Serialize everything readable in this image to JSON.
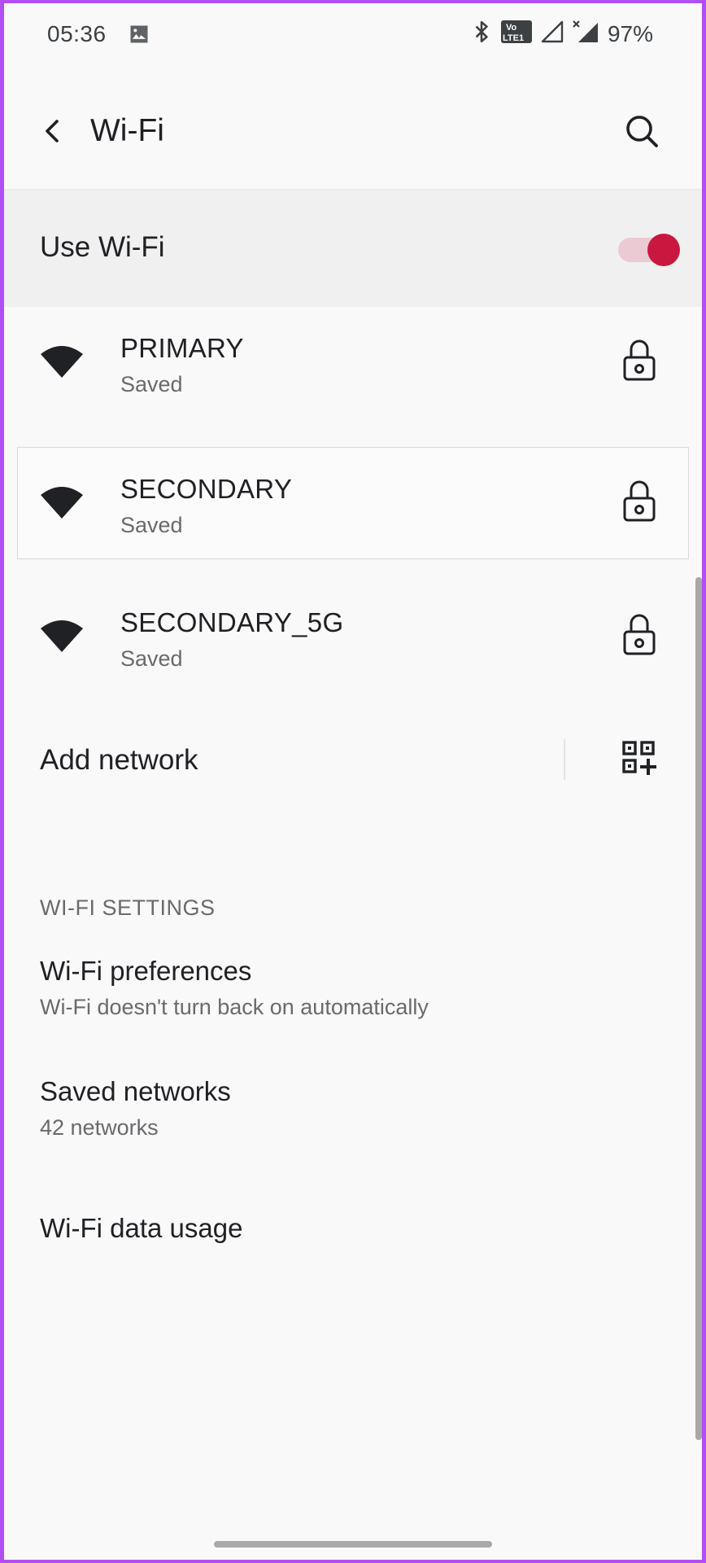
{
  "status_bar": {
    "time": "05:36",
    "battery": "97%",
    "icons": [
      "image-icon",
      "bluetooth-icon",
      "volte-icon",
      "signal-icon",
      "signal-no-data-icon"
    ],
    "lte_label_top": "Vo",
    "lte_label_bottom": "LTE1"
  },
  "app_bar": {
    "title": "Wi-Fi",
    "back_icon": "back-arrow-icon",
    "search_icon": "search-icon"
  },
  "wifi_toggle": {
    "label": "Use Wi-Fi",
    "enabled": true,
    "accent": "#c8183f",
    "track": "#eccad3"
  },
  "networks": [
    {
      "name": "PRIMARY",
      "status": "Saved",
      "secured": true
    },
    {
      "name": "SECONDARY",
      "status": "Saved",
      "secured": true
    },
    {
      "name": "SECONDARY_5G",
      "status": "Saved",
      "secured": true
    }
  ],
  "add_network": {
    "label": "Add network",
    "qr_icon": "qr-code-add-icon"
  },
  "settings": {
    "header": "WI-FI SETTINGS",
    "items": [
      {
        "title": "Wi-Fi preferences",
        "subtitle": "Wi-Fi doesn't turn back on automatically"
      },
      {
        "title": "Saved networks",
        "subtitle": "42 networks"
      },
      {
        "title": "Wi-Fi data usage"
      }
    ]
  },
  "colors": {
    "frame": "#b14ef5",
    "background": "#f9f9fa",
    "text_primary": "#202124",
    "text_secondary": "#6a6a6d"
  }
}
